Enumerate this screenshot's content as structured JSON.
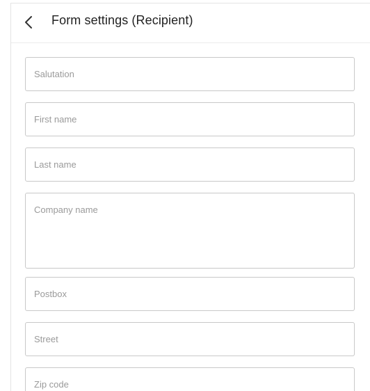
{
  "header": {
    "back_icon": "chevron-left-icon",
    "title": "Form settings (Recipient)"
  },
  "form": {
    "fields": [
      {
        "name": "salutation",
        "placeholder": "Salutation",
        "value": ""
      },
      {
        "name": "first-name",
        "placeholder": "First name",
        "value": ""
      },
      {
        "name": "last-name",
        "placeholder": "Last name",
        "value": ""
      },
      {
        "name": "company-name",
        "placeholder": "Company name",
        "value": "",
        "multiline": true
      },
      {
        "name": "postbox",
        "placeholder": "Postbox",
        "value": ""
      },
      {
        "name": "street",
        "placeholder": "Street",
        "value": ""
      },
      {
        "name": "zip-code",
        "placeholder": "Zip code",
        "value": ""
      }
    ]
  },
  "colors": {
    "border": "#c8c8c8",
    "placeholder": "#9a9a9a",
    "title": "#222222"
  }
}
